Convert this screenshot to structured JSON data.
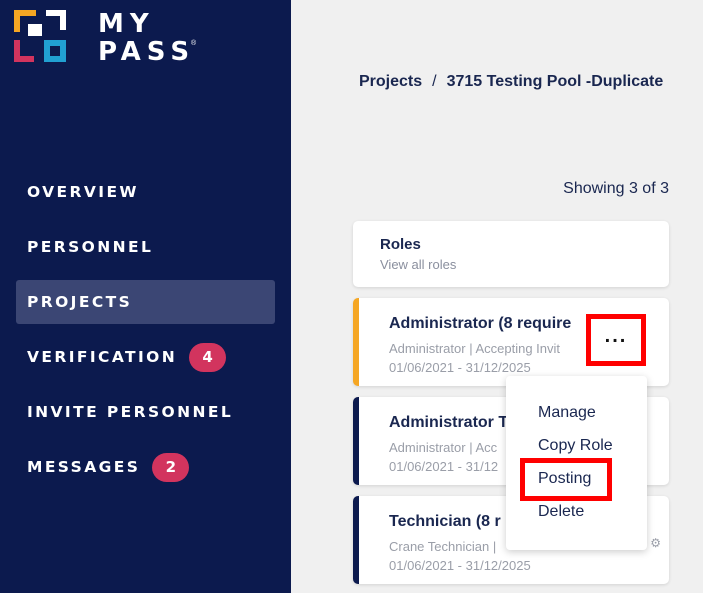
{
  "brand": {
    "line1": "MY",
    "line2": "PASS",
    "reg": "®"
  },
  "sidebar": {
    "items": [
      {
        "label": "OVERVIEW"
      },
      {
        "label": "PERSONNEL"
      },
      {
        "label": "PROJECTS",
        "active": true
      },
      {
        "label": "VERIFICATION",
        "badge": "4"
      },
      {
        "label": "INVITE PERSONNEL"
      },
      {
        "label": "MESSAGES",
        "badge": "2"
      }
    ]
  },
  "breadcrumb": {
    "root": "Projects",
    "separator": "/",
    "current": "3715 Testing Pool -Duplicate"
  },
  "showing": "Showing 3 of 3",
  "roles_card": {
    "title": "Roles",
    "subtitle": "View all roles"
  },
  "role_cards": [
    {
      "title": "Administrator (8 require",
      "meta": "Administrator | Accepting Invit",
      "dates": "01/06/2021 - 31/12/2025"
    },
    {
      "title": "Administrator T",
      "meta": "Administrator | Acc",
      "dates": "01/06/2021 - 31/12"
    },
    {
      "title": "Technician (8 r",
      "meta": "Crane Technician | ",
      "dates": "01/06/2021 - 31/12/2025"
    }
  ],
  "more_button": {
    "label": "..."
  },
  "menu": {
    "items": [
      "Manage",
      "Copy Role",
      "Posting",
      "Delete"
    ]
  },
  "colors": {
    "sidebar": "#0c1a4e",
    "badge": "#d2345e",
    "accent": "#f5a623",
    "highlight": "#ff0000"
  }
}
